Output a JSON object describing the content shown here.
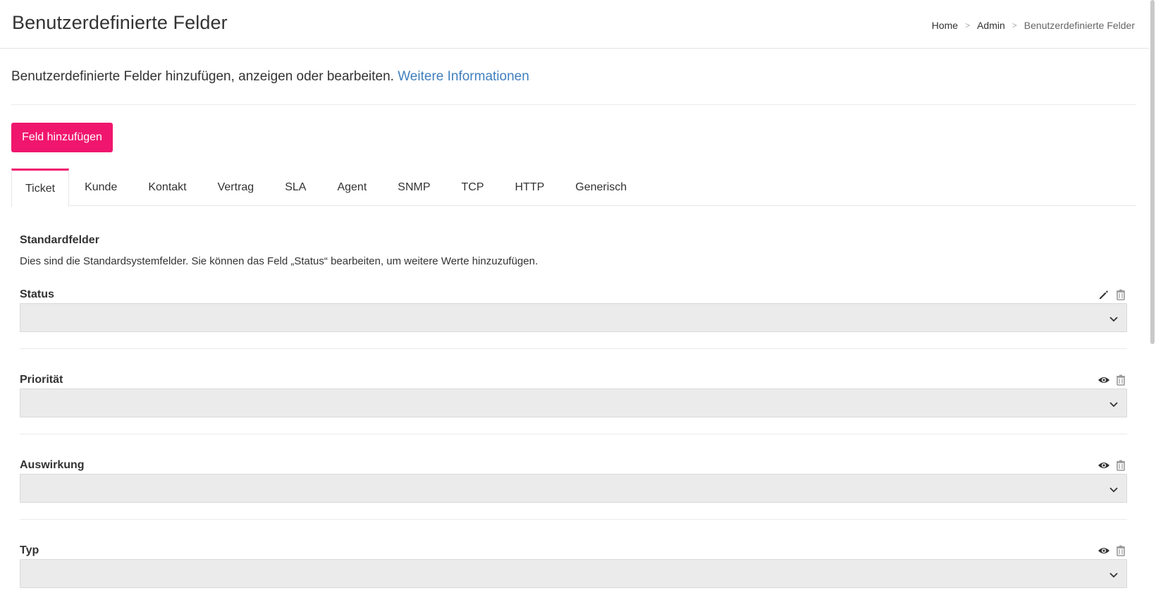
{
  "header": {
    "title": "Benutzerdefinierte Felder",
    "breadcrumb": [
      "Home",
      "Admin",
      "Benutzerdefinierte Felder"
    ],
    "breadcrumb_separator": ">"
  },
  "intro": {
    "text": "Benutzerdefinierte Felder hinzufügen, anzeigen oder bearbeiten.",
    "link_text": "Weitere Informationen"
  },
  "toolbar": {
    "add_label": "Feld hinzufügen"
  },
  "tabs": [
    "Ticket",
    "Kunde",
    "Kontakt",
    "Vertrag",
    "SLA",
    "Agent",
    "SNMP",
    "TCP",
    "HTTP",
    "Generisch"
  ],
  "active_tab": "Ticket",
  "section": {
    "title": "Standardfelder",
    "description": "Dies sind die Standardsystemfelder. Sie können das Feld „Status“ bearbeiten, um weitere Werte hinzuzufügen."
  },
  "fields": [
    {
      "label": "Status",
      "primary_action_icon": "pencil-icon",
      "secondary_action_icon": "trash-icon",
      "value": ""
    },
    {
      "label": "Priorität",
      "primary_action_icon": "eye-icon",
      "secondary_action_icon": "trash-icon",
      "value": ""
    },
    {
      "label": "Auswirkung",
      "primary_action_icon": "eye-icon",
      "secondary_action_icon": "trash-icon",
      "value": ""
    },
    {
      "label": "Typ",
      "primary_action_icon": "eye-icon",
      "secondary_action_icon": "trash-icon",
      "value": ""
    }
  ],
  "colors": {
    "accent": "#f0166e",
    "link": "#3f7fbf",
    "select_bg": "#ebebeb",
    "icon": "#333333",
    "icon_disabled": "#999999"
  }
}
